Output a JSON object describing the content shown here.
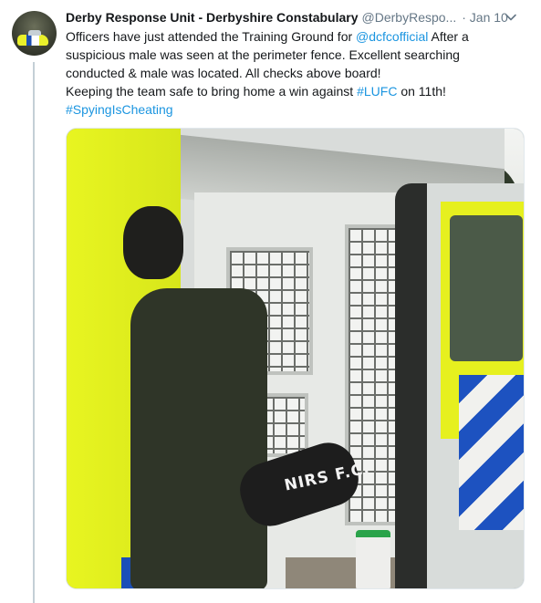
{
  "author": {
    "display_name": "Derby Response Unit - Derbyshire Constabulary",
    "handle": "@DerbyRespo...",
    "time": "· Jan 10"
  },
  "tweet": {
    "line1_pre": "Officers have just attended the Training Ground for ",
    "mention": "@dcfcofficial",
    "line1_post": " After a suspicious male was seen at the perimeter fence. Excellent searching conducted & male was located. All checks above board!",
    "line2_pre": "Keeping the team safe to bring home a win against ",
    "hashtag_lufc": "#LUFC",
    "line2_post": " on 11th!",
    "hashtag_spying": "#SpyingIsCheating"
  },
  "media": {
    "leg_text": "NIRS F.C."
  },
  "icons": {
    "menu": "chevron-down-icon"
  },
  "colors": {
    "link": "#1b95e0",
    "secondary_text": "#657786",
    "thread_line": "#c4cfd6"
  }
}
